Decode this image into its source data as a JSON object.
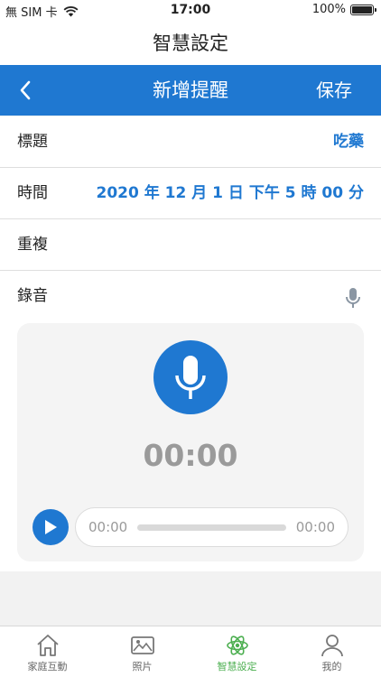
{
  "status": {
    "carrier": "無 SIM 卡",
    "time": "17:00",
    "battery": "100%"
  },
  "app_title": "智慧設定",
  "nav": {
    "title": "新增提醒",
    "save_label": "保存"
  },
  "form": {
    "title_label": "標題",
    "title_value": "吃藥",
    "time_label": "時間",
    "time_value": "2020 年 12 月 1 日 下午 5 時 00 分",
    "repeat_label": "重複",
    "record_label": "錄音"
  },
  "recorder": {
    "elapsed": "00:00",
    "player_current": "00:00",
    "player_total": "00:00",
    "progress": 0
  },
  "tabs": [
    {
      "label": "家庭互動",
      "icon": "home-icon"
    },
    {
      "label": "照片",
      "icon": "photo-icon"
    },
    {
      "label": "智慧設定",
      "icon": "atom-icon"
    },
    {
      "label": "我的",
      "icon": "person-icon"
    }
  ],
  "colors": {
    "accent": "#1f78d1",
    "active_tab": "#4caf50",
    "muted_text": "#9a9a9a"
  }
}
